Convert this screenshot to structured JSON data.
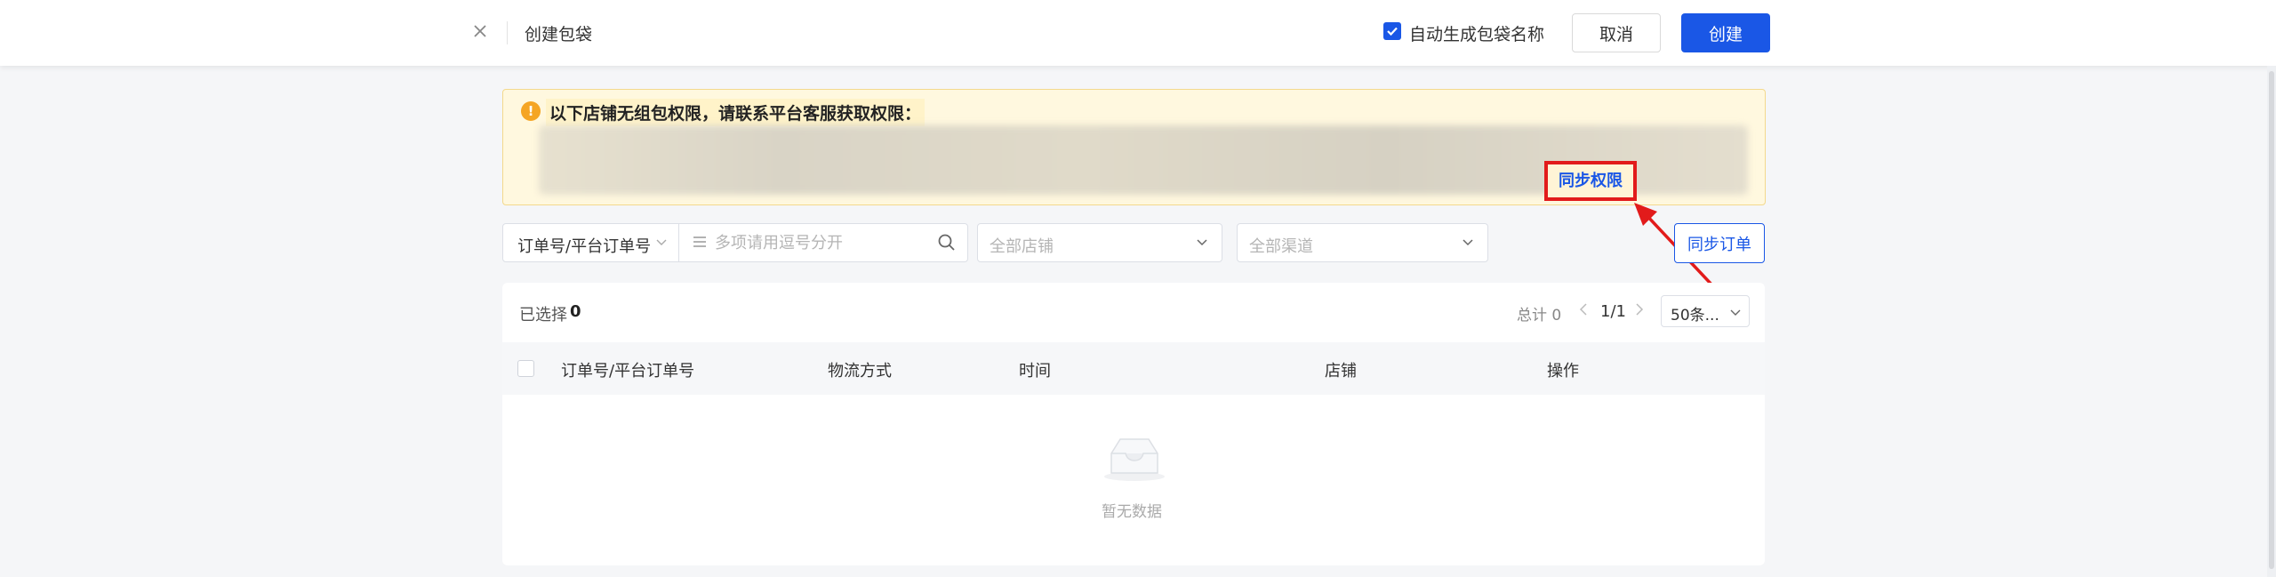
{
  "header": {
    "title": "创建包袋",
    "auto_name_label": "自动生成包袋名称",
    "auto_name_checked": true,
    "cancel_label": "取消",
    "create_label": "创建"
  },
  "notice": {
    "text": "以下店铺无组包权限，请联系平台客服获取权限：",
    "action_label": "同步权限"
  },
  "filters": {
    "order_type_label": "订单号/平台订单号",
    "search_placeholder": "多项请用逗号分开",
    "shop_placeholder": "全部店铺",
    "channel_placeholder": "全部渠道",
    "sync_order_label": "同步订单"
  },
  "table": {
    "selected_label": "已选择",
    "selected_count": "0",
    "total_label": "总计 0",
    "page": "1/1",
    "page_size": "50条...",
    "columns": [
      "订单号/平台订单号",
      "物流方式",
      "时间",
      "店铺",
      "操作"
    ],
    "empty_text": "暂无数据"
  },
  "colors": {
    "primary": "#1a57e6",
    "warning_bg": "#fff8df",
    "highlight_red": "#e21b1b"
  }
}
